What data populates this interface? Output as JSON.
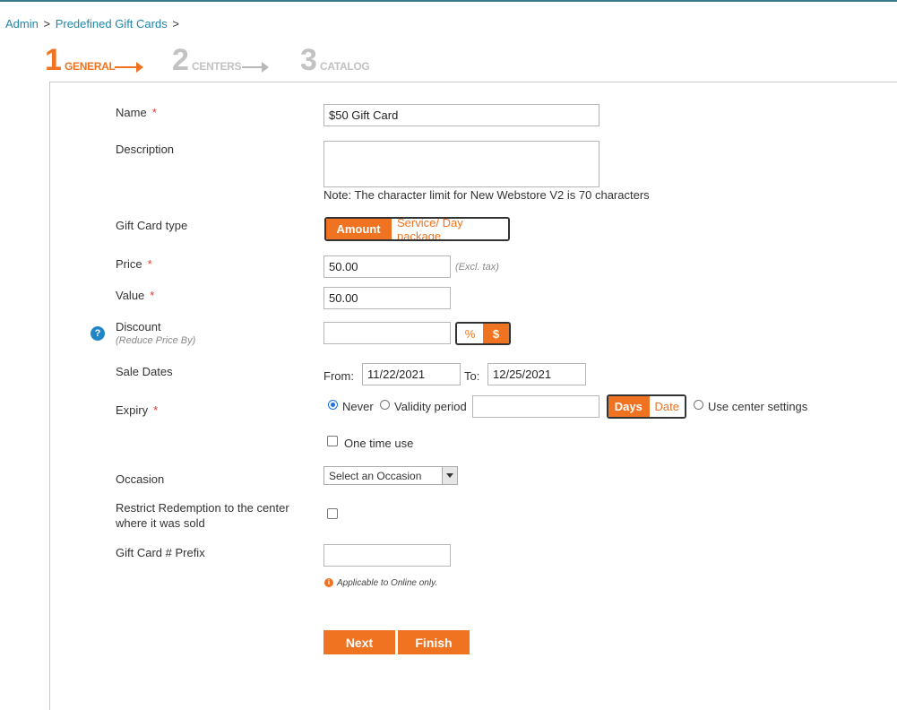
{
  "breadcrumb": {
    "admin": "Admin",
    "sep1": ">",
    "gift_cards": "Predefined Gift Cards",
    "sep2": ">"
  },
  "steps": [
    {
      "number": "1",
      "label": "GENERAL"
    },
    {
      "number": "2",
      "label": "CENTERS"
    },
    {
      "number": "3",
      "label": "CATALOG"
    }
  ],
  "form": {
    "name": {
      "label": "Name",
      "required": "*",
      "value": "$50 Gift Card"
    },
    "description": {
      "label": "Description",
      "value": "",
      "note": "Note: The character limit for New Webstore V2 is 70 characters"
    },
    "gift_card_type": {
      "label": "Gift Card type",
      "option_amount": "Amount",
      "option_service": "Service/ Day package",
      "selected": "Amount"
    },
    "price": {
      "label": "Price",
      "required": "*",
      "value": "50.00",
      "hint": "(Excl. tax)"
    },
    "value": {
      "label": "Value",
      "required": "*",
      "value": "50.00"
    },
    "discount": {
      "label": "Discount",
      "sublabel": "(Reduce Price By)",
      "value": "",
      "pct": "%",
      "dollar": "$",
      "selected": "$",
      "help_icon": "question-icon"
    },
    "sale_dates": {
      "label": "Sale Dates",
      "from_label": "From:",
      "from_value": "11/22/2021",
      "to_label": "To:",
      "to_value": "12/25/2021"
    },
    "expiry": {
      "label": "Expiry",
      "required": "*",
      "never": "Never",
      "validity": "Validity period",
      "validity_value": "",
      "days": "Days",
      "date": "Date",
      "use_center": "Use center settings",
      "selected": "Never",
      "unit_selected": "Days",
      "one_time_use": "One time use",
      "one_time_use_checked": false
    },
    "occasion": {
      "label": "Occasion",
      "value": "Select an Occasion"
    },
    "restrict": {
      "label_line1": "Restrict Redemption to the center",
      "label_line2": "where it was sold",
      "checked": false
    },
    "prefix": {
      "label": "Gift Card # Prefix",
      "value": "",
      "info": "Applicable to Online only."
    }
  },
  "buttons": {
    "next": "Next",
    "finish": "Finish"
  },
  "colors": {
    "accent": "#f07322",
    "link": "#1f86a8",
    "required": "#e0392d",
    "help": "#1f86c8"
  }
}
